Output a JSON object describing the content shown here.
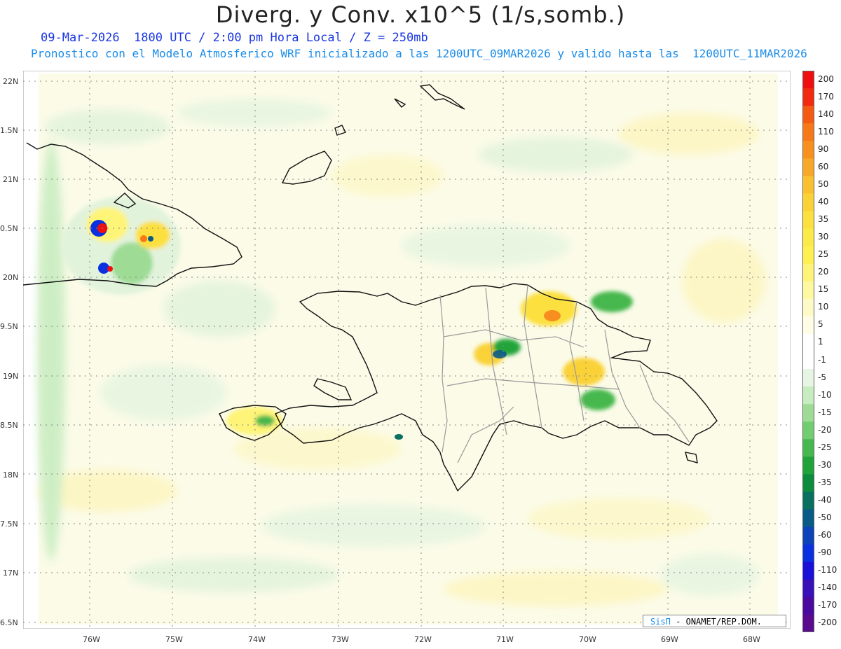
{
  "header": {
    "title": "Diverg. y Conv. x10^5 (1/s,somb.)",
    "subtitle1": "09-Mar-2026  1800 UTC / 2:00 pm Hora Local / Z = 250mb",
    "subtitle2": "Pronostico con el Modelo Atmosferico WRF inicializado a las 1200UTC_09MAR2026 y valido hasta las  1200UTC_11MAR2026"
  },
  "axes": {
    "lat_labels": [
      "22N",
      "1.5N",
      "21N",
      "0.5N",
      "20N",
      "9.5N",
      "19N",
      "8.5N",
      "18N",
      "7.5N",
      "17N",
      "6.5N"
    ],
    "lon_labels": [
      "76W",
      "75W",
      "74W",
      "73W",
      "72W",
      "71W",
      "70W",
      "69W",
      "68W"
    ]
  },
  "colorbar": {
    "labels": [
      "200",
      "170",
      "140",
      "110",
      "90",
      "60",
      "50",
      "40",
      "35",
      "30",
      "25",
      "20",
      "15",
      "10",
      "5",
      "1",
      "-1",
      "-5",
      "-10",
      "-15",
      "-20",
      "-25",
      "-30",
      "-35",
      "-40",
      "-50",
      "-60",
      "-90",
      "-110",
      "-140",
      "-170",
      "-200"
    ],
    "colors": [
      "#ee1010",
      "#f22a10",
      "#f45a12",
      "#f67818",
      "#f89020",
      "#f8a828",
      "#fac030",
      "#fad238",
      "#fce040",
      "#fcea48",
      "#fef050",
      "#fef478",
      "#fef8a0",
      "#fefac8",
      "#fffde6",
      "#ffffff",
      "#ffffff",
      "#e6f6e2",
      "#c6ecc0",
      "#9edc96",
      "#72cc70",
      "#46b84e",
      "#20a43a",
      "#0c8c3c",
      "#0a7060",
      "#0a5a88",
      "#0a44b8",
      "#0a30e0",
      "#1a10d8",
      "#3a10b8",
      "#4a0aa0",
      "#5a0a8c"
    ]
  },
  "credit": {
    "brand": "SisΠ",
    "text": "- ONAMET/REP.DOM."
  }
}
